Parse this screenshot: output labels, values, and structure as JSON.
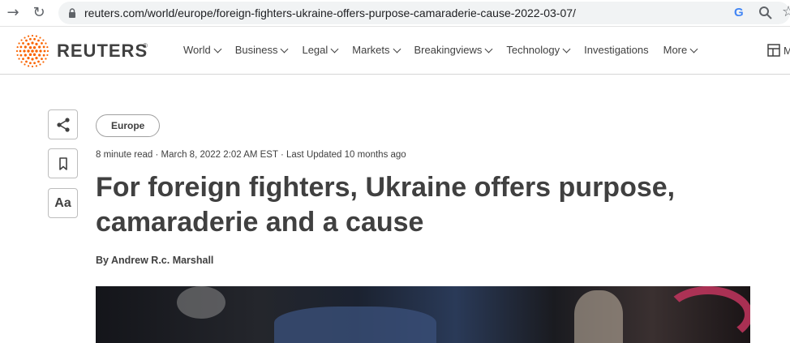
{
  "browser": {
    "url": "reuters.com/world/europe/foreign-fighters-ukraine-offers-purpose-camaraderie-cause-2022-03-07/",
    "google_glyph": "G"
  },
  "header": {
    "logo_text": "REUTERS",
    "logo_registered": "®",
    "brand_color": "#fa6400",
    "nav": [
      {
        "label": "World",
        "dropdown": true
      },
      {
        "label": "Business",
        "dropdown": true
      },
      {
        "label": "Legal",
        "dropdown": true
      },
      {
        "label": "Markets",
        "dropdown": true
      },
      {
        "label": "Breakingviews",
        "dropdown": true
      },
      {
        "label": "Technology",
        "dropdown": true
      },
      {
        "label": "Investigations",
        "dropdown": false
      },
      {
        "label": "More",
        "dropdown": true
      }
    ],
    "truncated_label": "M"
  },
  "tools": {
    "font_size_label": "Aa"
  },
  "article": {
    "section_tag": "Europe",
    "meta": "8 minute read · March 8, 2022 2:02 AM EST · Last Updated 10 months ago",
    "headline": "For foreign fighters, Ukraine offers purpose, camaraderie and a cause",
    "byline": "By Andrew R.c. Marshall"
  }
}
